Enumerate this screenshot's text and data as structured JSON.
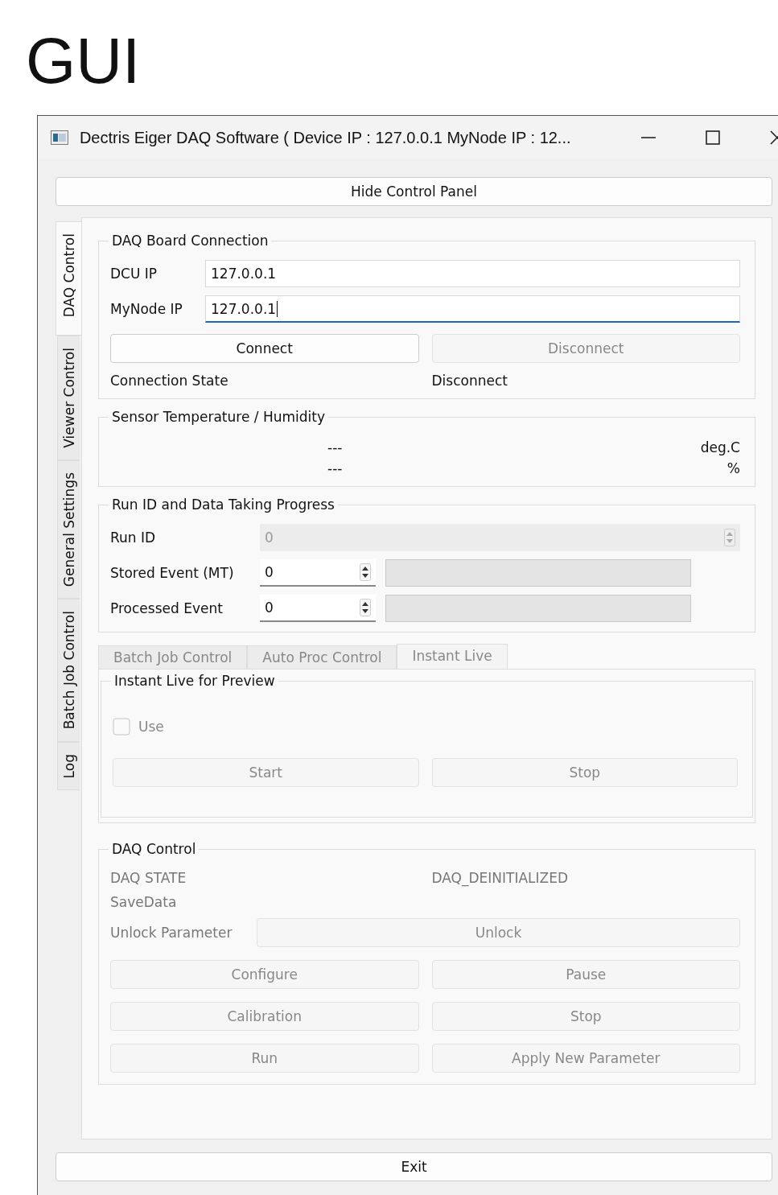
{
  "heading": "GUI",
  "window": {
    "title": "Dectris Eiger DAQ Software ( Device IP : 127.0.0.1 MyNode IP : 12..."
  },
  "hide_button": "Hide Control Panel",
  "side_tabs": [
    {
      "label": "DAQ Control",
      "selected": true
    },
    {
      "label": "Viewer Control",
      "selected": false
    },
    {
      "label": "General Settings",
      "selected": false
    },
    {
      "label": "Batch Job Control",
      "selected": false
    },
    {
      "label": "Log",
      "selected": false
    }
  ],
  "daq_board_connection": {
    "title": "DAQ Board Connection",
    "fields": [
      {
        "label": "DCU IP",
        "value": "127.0.0.1",
        "focused": false
      },
      {
        "label": "MyNode IP",
        "value": "127.0.0.1",
        "focused": true
      }
    ],
    "buttons": [
      {
        "label": "Connect",
        "disabled": false
      },
      {
        "label": "Disconnect",
        "disabled": true
      }
    ],
    "state_label": "Connection State",
    "state_value": "Disconnect"
  },
  "sensor": {
    "title": "Sensor Temperature / Humidity",
    "rows": [
      {
        "value": "---",
        "unit": "deg.C"
      },
      {
        "value": "---",
        "unit": "%"
      }
    ]
  },
  "run_progress": {
    "title": "Run ID and Data Taking Progress",
    "rows": [
      {
        "kind": "wide",
        "label": "Run ID",
        "value": "0",
        "disabled": true
      },
      {
        "kind": "progress",
        "label": "Stored Event (MT)",
        "value": "0",
        "disabled": false,
        "level": 0
      },
      {
        "kind": "progress",
        "label": "Processed Event",
        "value": "0",
        "disabled": false,
        "level": 0
      }
    ]
  },
  "sub_tabs": [
    {
      "label": "Batch Job Control",
      "selected": false
    },
    {
      "label": "Auto Proc Control",
      "selected": false
    },
    {
      "label": "Instant Live",
      "selected": true
    }
  ],
  "instant_live": {
    "title": "Instant Live for Preview",
    "checkbox": {
      "label": "Use",
      "checked": false,
      "disabled": true
    },
    "buttons": [
      {
        "label": "Start",
        "disabled": true
      },
      {
        "label": "Stop",
        "disabled": true
      }
    ]
  },
  "daq_control": {
    "title": "DAQ Control",
    "state_label": "DAQ STATE",
    "state_value": "DAQ_DEINITIALIZED",
    "savedata_label": "SaveData",
    "unlock_label": "Unlock Parameter",
    "unlock_button": {
      "label": "Unlock",
      "disabled": true
    },
    "buttons": [
      {
        "label": "Configure",
        "disabled": true
      },
      {
        "label": "Pause",
        "disabled": true
      },
      {
        "label": "Calibration",
        "disabled": true
      },
      {
        "label": "Stop",
        "disabled": true
      },
      {
        "label": "Run",
        "disabled": true
      },
      {
        "label": "Apply New Parameter",
        "disabled": true
      }
    ]
  },
  "exit_button": "Exit"
}
